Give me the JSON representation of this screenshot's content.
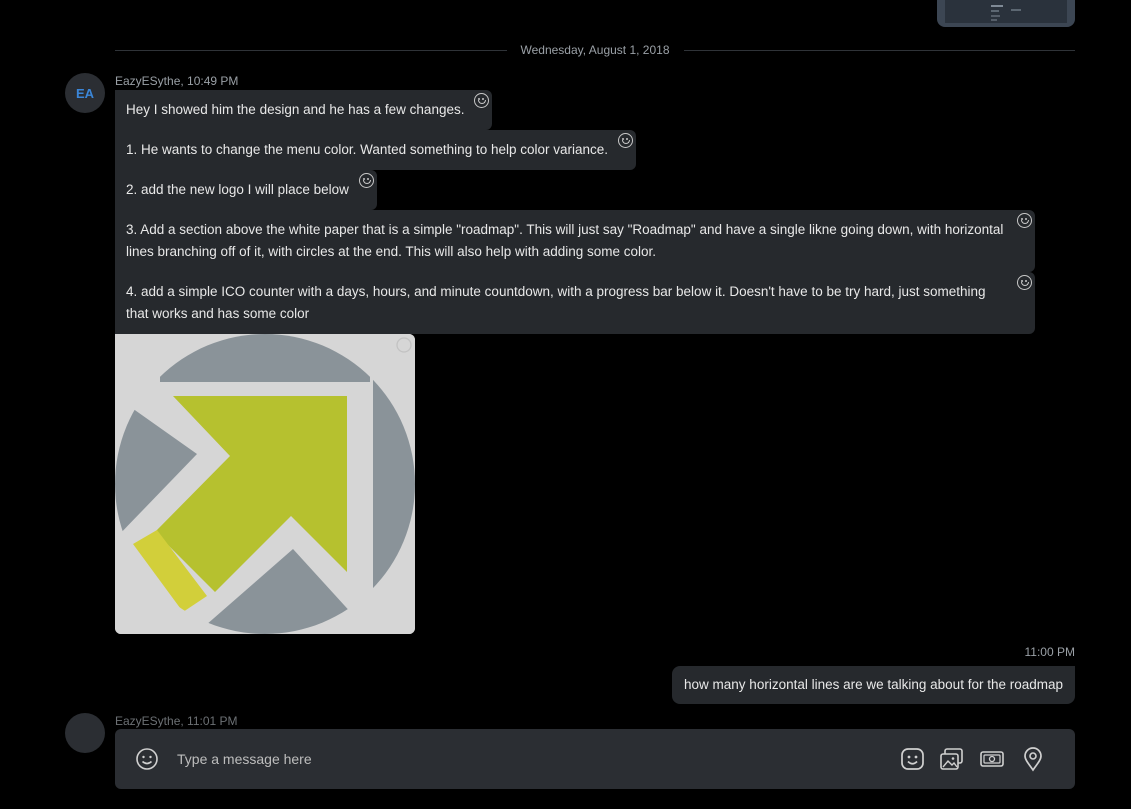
{
  "date_divider": "Wednesday, August 1, 2018",
  "sender": {
    "initials": "EA",
    "meta": "EazyESythe, 10:49 PM"
  },
  "messages": [
    "Hey I showed him the design and he has a few changes.",
    "1. He wants to change the menu color. Wanted something to help color variance.",
    "2. add the new logo I will place below",
    "3. Add a section above the white paper that is a simple \"roadmap\". This will just say \"Roadmap\" and have a single likne going down, with horizontal lines branching off of it, with circles at the end. This will also help with adding some color.",
    "4. add a simple ICO counter with a days, hours, and minute countdown, with a progress bar below it. Doesn't have to be try hard, just something that works and has some color"
  ],
  "own_message": {
    "time": "11:00 PM",
    "text": "how many horizontal lines are we talking about for the roadmap"
  },
  "next_sender_meta": "EazyESythe, 11:01 PM",
  "composer": {
    "placeholder": "Type a message here"
  },
  "icons": {
    "emoji": "emoji-icon",
    "sticker": "sticker-icon",
    "gallery": "gallery-icon",
    "money": "money-icon",
    "location": "location-pin-icon",
    "reaction": "reaction-smiley-icon"
  },
  "colors": {
    "background": "#000000",
    "bubble": "#26292d",
    "composer": "#2b2e33",
    "avatar_text": "#3b86d8",
    "logo_green": "#b6c12f",
    "logo_gray": "#8a9399",
    "logo_yellow": "#d2cf3a"
  }
}
